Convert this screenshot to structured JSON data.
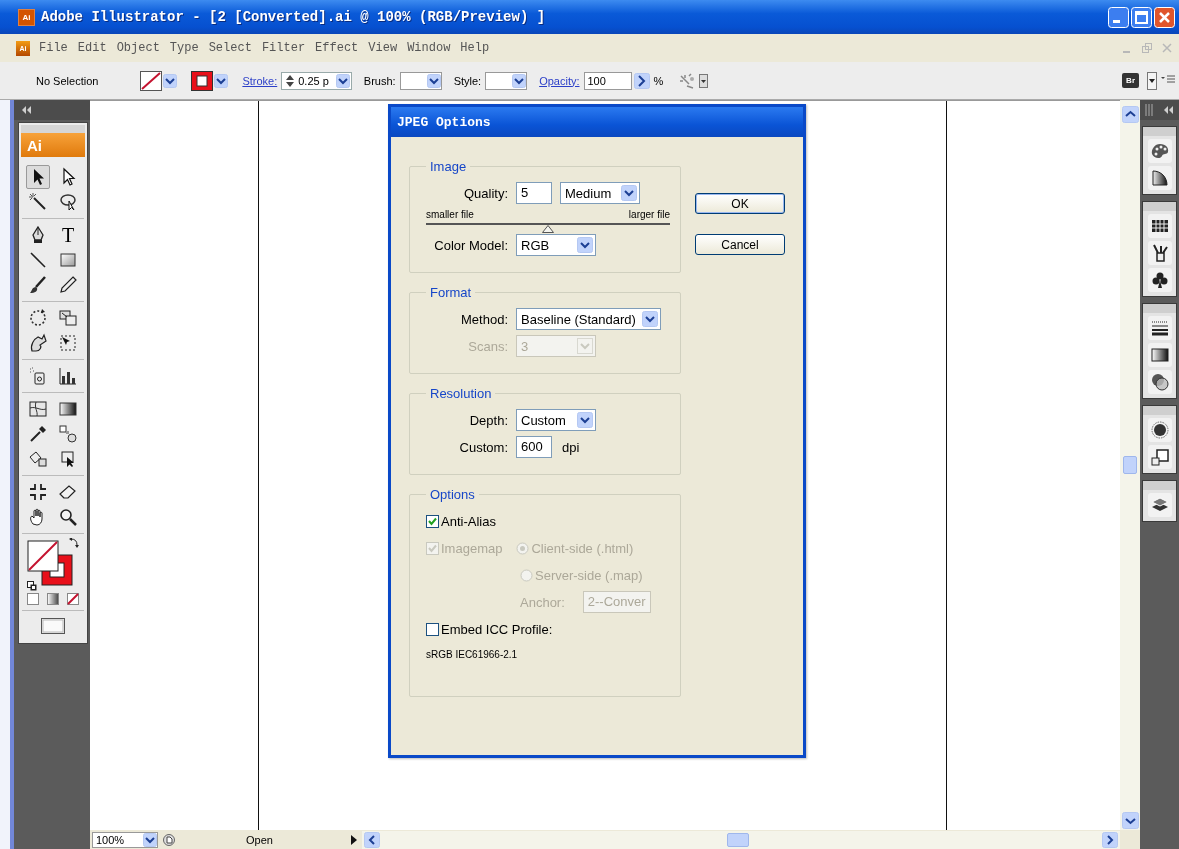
{
  "window": {
    "app_icon": "Ai",
    "title": "Adobe Illustrator - [2 [Converted].ai @ 100% (RGB/Preview) ]"
  },
  "menu_bar": {
    "icon": "Ai",
    "items": [
      "File",
      "Edit",
      "Object",
      "Type",
      "Select",
      "Filter",
      "Effect",
      "View",
      "Window",
      "Help"
    ]
  },
  "control_bar": {
    "selection": "No Selection",
    "stroke_link": "Stroke:",
    "stroke_weight": "0.25 p",
    "brush_label": "Brush:",
    "style_label": "Style:",
    "opacity_link": "Opacity:",
    "opacity": "100",
    "opacity_unit": "%",
    "bridge_button": "Br"
  },
  "toolbox": {
    "logo": "Ai",
    "tools": [
      {
        "selected": true
      },
      {
        "selected": false
      },
      {
        "selected": false
      },
      {
        "selected": false
      },
      {
        "selected": false
      },
      {
        "selected": false,
        "glyph": "T"
      },
      {
        "selected": false
      },
      {
        "selected": false
      },
      {
        "selected": false
      },
      {
        "selected": false
      },
      {
        "selected": false
      },
      {
        "selected": false
      },
      {
        "selected": false
      },
      {
        "selected": false
      },
      {
        "selected": false
      },
      {
        "selected": false
      },
      {
        "selected": false
      },
      {
        "selected": false
      },
      {
        "selected": false
      },
      {
        "selected": false
      },
      {
        "selected": false
      },
      {
        "selected": false
      },
      {
        "selected": false
      },
      {
        "selected": false
      },
      {
        "selected": false
      },
      {
        "selected": false
      }
    ]
  },
  "dialog": {
    "title": "JPEG Options",
    "buttons": [
      {
        "label": "OK",
        "default": true
      },
      {
        "label": "Cancel",
        "default": false
      }
    ],
    "groups": [
      {
        "title": "Image",
        "rows": [
          {
            "kind": "labeled",
            "label": "Quality:",
            "disabled": false,
            "controls": [
              {
                "kind": "field",
                "value": "5",
                "disabled": false
              },
              {
                "kind": "select",
                "value": "Medium",
                "disabled": false
              }
            ]
          },
          {
            "kind": "slider",
            "min_label": "smaller file",
            "max_label": "larger file",
            "level": 0.5
          },
          {
            "kind": "labeled",
            "label": "Color Model:",
            "disabled": false,
            "controls": [
              {
                "kind": "select",
                "value": "RGB",
                "disabled": false
              }
            ]
          }
        ]
      },
      {
        "title": "Format",
        "rows": [
          {
            "kind": "labeled",
            "label": "Method:",
            "disabled": false,
            "controls": [
              {
                "kind": "select",
                "value": "Baseline (Standard)",
                "disabled": false
              }
            ]
          },
          {
            "kind": "labeled",
            "label": "Scans:",
            "disabled": true,
            "controls": [
              {
                "kind": "select",
                "value": "3",
                "disabled": true
              }
            ]
          }
        ]
      },
      {
        "title": "Resolution",
        "rows": [
          {
            "kind": "labeled",
            "label": "Depth:",
            "disabled": false,
            "controls": [
              {
                "kind": "select",
                "value": "Custom",
                "disabled": false
              }
            ]
          },
          {
            "kind": "labeled",
            "label": "Custom:",
            "disabled": false,
            "controls": [
              {
                "kind": "field",
                "value": "600",
                "disabled": false
              },
              {
                "kind": "unit",
                "text": "dpi"
              }
            ]
          }
        ]
      },
      {
        "title": "Options",
        "rows": [
          {
            "kind": "free",
            "controls": [
              {
                "kind": "checkbox",
                "label": "Anti-Alias",
                "checked": true,
                "disabled": false
              }
            ]
          },
          {
            "kind": "free",
            "controls": [
              {
                "kind": "checkbox",
                "label": "Imagemap",
                "checked": true,
                "disabled": true
              },
              {
                "kind": "radio",
                "label": "Client-side (.html)",
                "selected": true,
                "disabled": true
              }
            ]
          },
          {
            "kind": "indented",
            "controls": [
              {
                "kind": "radio",
                "label": "Server-side (.map)",
                "selected": false,
                "disabled": true
              }
            ]
          },
          {
            "kind": "indented",
            "controls": [
              {
                "kind": "label",
                "text": "Anchor:",
                "disabled": true
              },
              {
                "kind": "field",
                "value": "2--Conver",
                "disabled": true
              }
            ]
          },
          {
            "kind": "free",
            "controls": [
              {
                "kind": "checkbox",
                "label": "Embed ICC Profile:",
                "checked": false,
                "disabled": false
              }
            ]
          },
          {
            "kind": "note",
            "text": "sRGB IEC61966-2.1"
          }
        ]
      }
    ]
  },
  "status_bar": {
    "zoom": "100%",
    "status": "Open"
  }
}
